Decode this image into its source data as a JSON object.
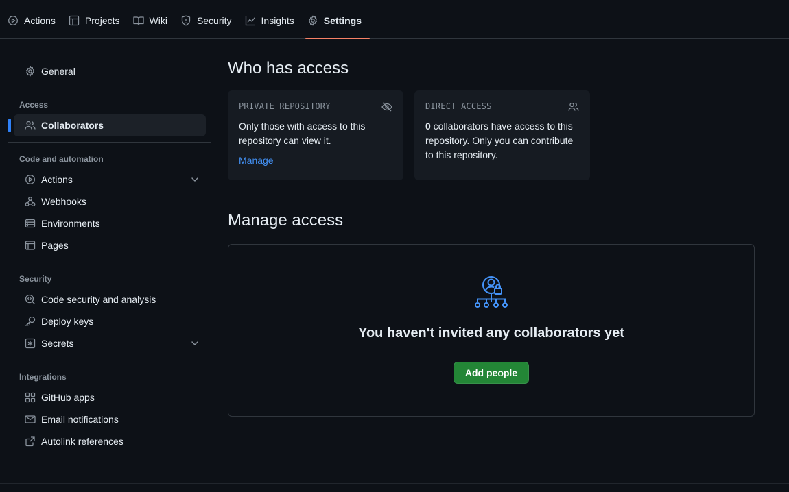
{
  "topnav": {
    "tabs": [
      {
        "label": "Actions",
        "icon": "play-icon"
      },
      {
        "label": "Projects",
        "icon": "table-icon"
      },
      {
        "label": "Wiki",
        "icon": "book-icon"
      },
      {
        "label": "Security",
        "icon": "shield-icon"
      },
      {
        "label": "Insights",
        "icon": "graph-icon"
      },
      {
        "label": "Settings",
        "icon": "gear-icon",
        "active": true
      }
    ]
  },
  "sidebar": {
    "general": "General",
    "access_heading": "Access",
    "collaborators": "Collaborators",
    "code_heading": "Code and automation",
    "actions": "Actions",
    "webhooks": "Webhooks",
    "environments": "Environments",
    "pages": "Pages",
    "security_heading": "Security",
    "code_security": "Code security and analysis",
    "deploy_keys": "Deploy keys",
    "secrets": "Secrets",
    "integrations_heading": "Integrations",
    "github_apps": "GitHub apps",
    "email_notifications": "Email notifications",
    "autolink": "Autolink references"
  },
  "main": {
    "who_title": "Who has access",
    "private_card": {
      "label": "PRIVATE REPOSITORY",
      "text": "Only those with access to this repository can view it.",
      "link": "Manage"
    },
    "direct_card": {
      "label": "DIRECT ACCESS",
      "count": "0",
      "text": " collaborators have access to this repository. Only you can contribute to this repository."
    },
    "manage_title": "Manage access",
    "empty_title": "You haven't invited any collaborators yet",
    "add_button": "Add people"
  },
  "colors": {
    "background": "#0d1117",
    "accent_tab": "#f78166",
    "link": "#4493f8",
    "primary_button": "#238636"
  }
}
